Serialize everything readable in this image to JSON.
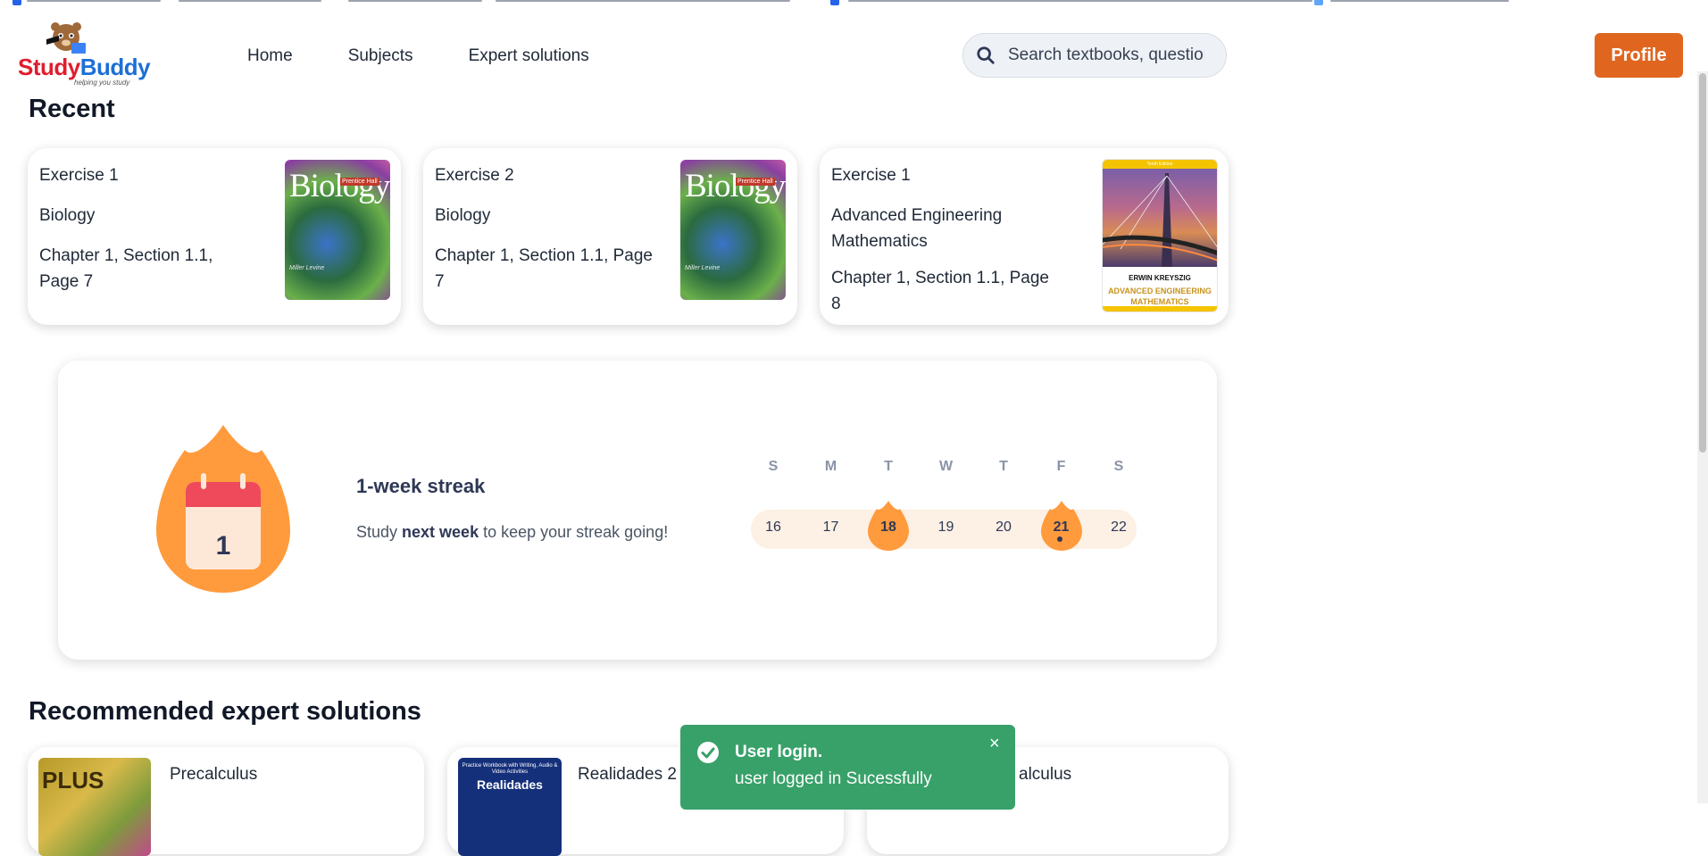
{
  "logo": {
    "study": "Study",
    "buddy": "Buddy",
    "tagline": "helping you study"
  },
  "nav": {
    "home": "Home",
    "subjects": "Subjects",
    "expert_solutions": "Expert solutions"
  },
  "search": {
    "placeholder": "Search textbooks, questions"
  },
  "profile": {
    "label": "Profile"
  },
  "recent": {
    "heading": "Recent",
    "cards": [
      {
        "exercise": "Exercise 1",
        "book": "Biology",
        "location": "Chapter 1, Section 1.1, Page 7",
        "cover": {
          "title": "Biology",
          "publisher": "Prentice Hall",
          "authors": "Miller Levine"
        }
      },
      {
        "exercise": "Exercise 2",
        "book": "Biology",
        "location": "Chapter 1, Section 1.1, Page 7",
        "cover": {
          "title": "Biology",
          "publisher": "Prentice Hall",
          "authors": "Miller Levine"
        }
      },
      {
        "exercise": "Exercise 1",
        "book": "Advanced Engineering Mathematics",
        "location": "Chapter 1, Section 1.1, Page 8",
        "cover": {
          "edition": "Tenth Edition",
          "author": "ERWIN KREYSZIG",
          "title_line1": "ADVANCED ENGINEERING",
          "title_line2": "MATHEMATICS"
        }
      }
    ]
  },
  "streak": {
    "count": "1",
    "title": "1-week streak",
    "sub_prefix": "Study ",
    "sub_bold": "next week",
    "sub_suffix": " to keep your streak going!",
    "days": [
      {
        "label": "S",
        "date": "16",
        "active": false
      },
      {
        "label": "M",
        "date": "17",
        "active": false
      },
      {
        "label": "T",
        "date": "18",
        "active": true
      },
      {
        "label": "W",
        "date": "19",
        "active": false
      },
      {
        "label": "T",
        "date": "20",
        "active": false
      },
      {
        "label": "F",
        "date": "21",
        "active": true
      },
      {
        "label": "S",
        "date": "22",
        "active": false
      }
    ],
    "colors": {
      "flame": "#ff9b3d",
      "calendar_top": "#ef4a5c",
      "calendar_body": "#fde8d8",
      "bar": "#fdf0e4"
    }
  },
  "recommended": {
    "heading": "Recommended expert solutions",
    "items": [
      {
        "title": "Precalculus",
        "cover_text": "PLUS"
      },
      {
        "title": "Realidades 2",
        "cover_small": "Practice Workbook with Writing, Audio & Video Activities",
        "cover_big": "Realidades"
      },
      {
        "title": "alculus"
      }
    ]
  },
  "toast": {
    "title": "User login.",
    "message": "user logged in Sucessfully",
    "close": "×",
    "color": "#38a169"
  }
}
